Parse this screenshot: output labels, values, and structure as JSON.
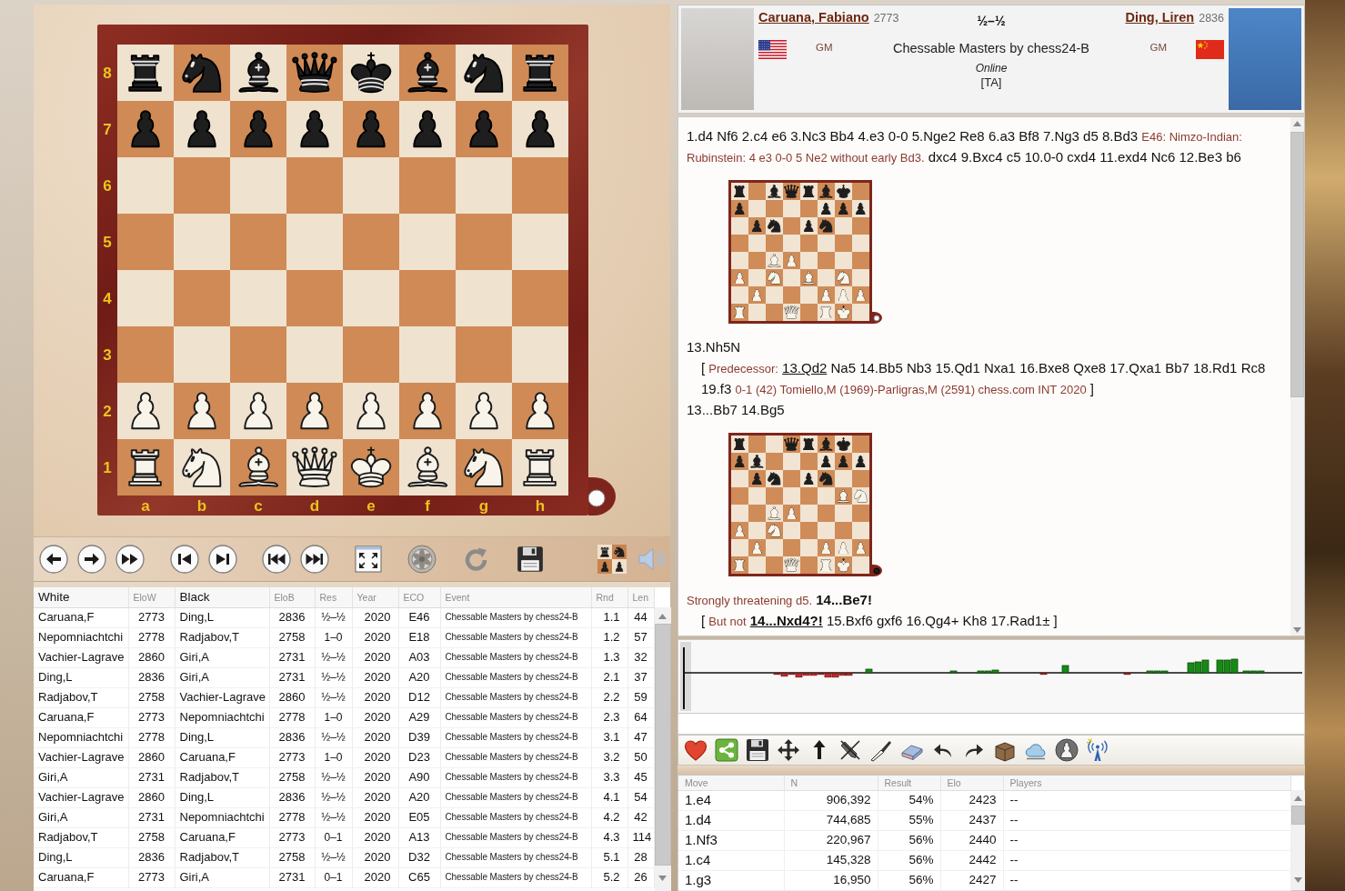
{
  "board": {
    "ranks": [
      {
        "label": "8",
        "squares": [
          {
            "kind": "rook",
            "color": "#1e1e1e"
          },
          {
            "kind": "knight",
            "color": "#1e1e1e"
          },
          {
            "kind": "bishop",
            "color": "#1e1e1e"
          },
          {
            "kind": "queen",
            "color": "#1e1e1e"
          },
          {
            "kind": "king",
            "color": "#1e1e1e"
          },
          {
            "kind": "bishop",
            "color": "#1e1e1e"
          },
          {
            "kind": "knight",
            "color": "#1e1e1e"
          },
          {
            "kind": "rook",
            "color": "#1e1e1e"
          }
        ]
      },
      {
        "label": "7",
        "squares": [
          {
            "kind": "pawn",
            "color": "#1e1e1e"
          },
          {
            "kind": "pawn",
            "color": "#1e1e1e"
          },
          {
            "kind": "pawn",
            "color": "#1e1e1e"
          },
          {
            "kind": "pawn",
            "color": "#1e1e1e"
          },
          {
            "kind": "pawn",
            "color": "#1e1e1e"
          },
          {
            "kind": "pawn",
            "color": "#1e1e1e"
          },
          {
            "kind": "pawn",
            "color": "#1e1e1e"
          },
          {
            "kind": "pawn",
            "color": "#1e1e1e"
          }
        ]
      },
      {
        "label": "6",
        "squares": [
          {
            "kind": "empty"
          },
          {
            "kind": "empty"
          },
          {
            "kind": "empty"
          },
          {
            "kind": "empty"
          },
          {
            "kind": "empty"
          },
          {
            "kind": "empty"
          },
          {
            "kind": "empty"
          },
          {
            "kind": "empty"
          }
        ]
      },
      {
        "label": "5",
        "squares": [
          {
            "kind": "empty"
          },
          {
            "kind": "empty"
          },
          {
            "kind": "empty"
          },
          {
            "kind": "empty"
          },
          {
            "kind": "empty"
          },
          {
            "kind": "empty"
          },
          {
            "kind": "empty"
          },
          {
            "kind": "empty"
          }
        ]
      },
      {
        "label": "4",
        "squares": [
          {
            "kind": "empty"
          },
          {
            "kind": "empty"
          },
          {
            "kind": "empty"
          },
          {
            "kind": "empty"
          },
          {
            "kind": "empty"
          },
          {
            "kind": "empty"
          },
          {
            "kind": "empty"
          },
          {
            "kind": "empty"
          }
        ]
      },
      {
        "label": "3",
        "squares": [
          {
            "kind": "empty"
          },
          {
            "kind": "empty"
          },
          {
            "kind": "empty"
          },
          {
            "kind": "empty"
          },
          {
            "kind": "empty"
          },
          {
            "kind": "empty"
          },
          {
            "kind": "empty"
          },
          {
            "kind": "empty"
          }
        ]
      },
      {
        "label": "2",
        "squares": [
          {
            "kind": "pawn",
            "color": "#f8f4ea"
          },
          {
            "kind": "pawn",
            "color": "#f8f4ea"
          },
          {
            "kind": "pawn",
            "color": "#f8f4ea"
          },
          {
            "kind": "pawn",
            "color": "#f8f4ea"
          },
          {
            "kind": "pawn",
            "color": "#f8f4ea"
          },
          {
            "kind": "pawn",
            "color": "#f8f4ea"
          },
          {
            "kind": "pawn",
            "color": "#f8f4ea"
          },
          {
            "kind": "pawn",
            "color": "#f8f4ea"
          }
        ]
      },
      {
        "label": "1",
        "squares": [
          {
            "kind": "rook",
            "color": "#f8f4ea"
          },
          {
            "kind": "knight",
            "color": "#f8f4ea"
          },
          {
            "kind": "bishop",
            "color": "#f8f4ea"
          },
          {
            "kind": "queen",
            "color": "#f8f4ea"
          },
          {
            "kind": "king",
            "color": "#f8f4ea"
          },
          {
            "kind": "bishop",
            "color": "#f8f4ea"
          },
          {
            "kind": "knight",
            "color": "#f8f4ea"
          },
          {
            "kind": "rook",
            "color": "#f8f4ea"
          }
        ]
      }
    ],
    "files": [
      "a",
      "b",
      "c",
      "d",
      "e",
      "f",
      "g",
      "h"
    ],
    "white_to_move": true
  },
  "game_list": {
    "columns": [
      {
        "label": "White",
        "emphasized": true
      },
      {
        "label": "EloW",
        "emphasized": false
      },
      {
        "label": "Black",
        "emphasized": true
      },
      {
        "label": "EloB",
        "emphasized": false
      },
      {
        "label": "Res",
        "emphasized": false
      },
      {
        "label": "Year",
        "emphasized": false
      },
      {
        "label": "ECO",
        "emphasized": false
      },
      {
        "label": "Event",
        "emphasized": false
      },
      {
        "label": "Rnd",
        "emphasized": false
      },
      {
        "label": "Len",
        "emphasized": false
      }
    ],
    "rows": [
      [
        "Caruana,F",
        "2773",
        "Ding,L",
        "2836",
        "½–½",
        "2020",
        "E46",
        "Chessable Masters by chess24-B",
        "1.1",
        "44"
      ],
      [
        "Nepomniachtchi",
        "2778",
        "Radjabov,T",
        "2758",
        "1–0",
        "2020",
        "E18",
        "Chessable Masters by chess24-B",
        "1.2",
        "57"
      ],
      [
        "Vachier-Lagrave",
        "2860",
        "Giri,A",
        "2731",
        "½–½",
        "2020",
        "A03",
        "Chessable Masters by chess24-B",
        "1.3",
        "32"
      ],
      [
        "Ding,L",
        "2836",
        "Giri,A",
        "2731",
        "½–½",
        "2020",
        "A20",
        "Chessable Masters by chess24-B",
        "2.1",
        "37"
      ],
      [
        "Radjabov,T",
        "2758",
        "Vachier-Lagrave",
        "2860",
        "½–½",
        "2020",
        "D12",
        "Chessable Masters by chess24-B",
        "2.2",
        "59"
      ],
      [
        "Caruana,F",
        "2773",
        "Nepomniachtchi",
        "2778",
        "1–0",
        "2020",
        "A29",
        "Chessable Masters by chess24-B",
        "2.3",
        "64"
      ],
      [
        "Nepomniachtchi",
        "2778",
        "Ding,L",
        "2836",
        "½–½",
        "2020",
        "D39",
        "Chessable Masters by chess24-B",
        "3.1",
        "47"
      ],
      [
        "Vachier-Lagrave",
        "2860",
        "Caruana,F",
        "2773",
        "1–0",
        "2020",
        "D23",
        "Chessable Masters by chess24-B",
        "3.2",
        "50"
      ],
      [
        "Giri,A",
        "2731",
        "Radjabov,T",
        "2758",
        "½–½",
        "2020",
        "A90",
        "Chessable Masters by chess24-B",
        "3.3",
        "45"
      ],
      [
        "Vachier-Lagrave",
        "2860",
        "Ding,L",
        "2836",
        "½–½",
        "2020",
        "A20",
        "Chessable Masters by chess24-B",
        "4.1",
        "54"
      ],
      [
        "Giri,A",
        "2731",
        "Nepomniachtchi",
        "2778",
        "½–½",
        "2020",
        "E05",
        "Chessable Masters by chess24-B",
        "4.2",
        "42"
      ],
      [
        "Radjabov,T",
        "2758",
        "Caruana,F",
        "2773",
        "0–1",
        "2020",
        "A13",
        "Chessable Masters by chess24-B",
        "4.3",
        "114"
      ],
      [
        "Ding,L",
        "2836",
        "Radjabov,T",
        "2758",
        "½–½",
        "2020",
        "D32",
        "Chessable Masters by chess24-B",
        "5.1",
        "28"
      ],
      [
        "Caruana,F",
        "2773",
        "Giri,A",
        "2731",
        "0–1",
        "2020",
        "C65",
        "Chessable Masters by chess24-B",
        "5.2",
        "26"
      ]
    ]
  },
  "game_header": {
    "players": [
      {
        "name": "Caruana, Fabiano",
        "elo": "2773",
        "title": "GM",
        "flag": {
          "kind": "us"
        }
      },
      {
        "name": "Ding, Liren",
        "elo": "2836",
        "title": "GM",
        "flag": {
          "kind": "cn"
        }
      }
    ],
    "result": "½–½",
    "event": "Chessable Masters by chess24-B",
    "site": "Online",
    "annotator": "[TA]"
  },
  "notation": [
    {
      "kind": "line",
      "segments": [
        {
          "kind": "move",
          "text": "1.d4 Nf6 2.c4 e6 3.Nc3 Bb4 4.e3 0-0 5.Nge2 Re8 6.a3 Bf8 7.Ng3 d5 8.Bd3"
        },
        {
          "kind": "comment",
          "text": "E46: Nimzo-Indian:"
        }
      ]
    },
    {
      "kind": "line",
      "segments": [
        {
          "kind": "comment",
          "text": "Rubinstein: 4 e3 0-0 5 Ne2 without early Bd3."
        },
        {
          "kind": "move",
          "text": "dxc4 9.Bxc4 c5 10.0-0 cxd4 11.exd4 Nc6 12.Be3 b6"
        }
      ]
    },
    {
      "kind": "diagram",
      "white_to_move": true,
      "ranks": [
        {
          "squares": [
            {
              "kind": "rook",
              "color": "#1e1e1e"
            },
            {
              "kind": "empty"
            },
            {
              "kind": "bishop",
              "color": "#1e1e1e"
            },
            {
              "kind": "queen",
              "color": "#1e1e1e"
            },
            {
              "kind": "rook",
              "color": "#1e1e1e"
            },
            {
              "kind": "bishop",
              "color": "#1e1e1e"
            },
            {
              "kind": "king",
              "color": "#1e1e1e"
            },
            {
              "kind": "empty"
            }
          ]
        },
        {
          "squares": [
            {
              "kind": "pawn",
              "color": "#1e1e1e"
            },
            {
              "kind": "empty"
            },
            {
              "kind": "empty"
            },
            {
              "kind": "empty"
            },
            {
              "kind": "empty"
            },
            {
              "kind": "pawn",
              "color": "#1e1e1e"
            },
            {
              "kind": "pawn",
              "color": "#1e1e1e"
            },
            {
              "kind": "pawn",
              "color": "#1e1e1e"
            }
          ]
        },
        {
          "squares": [
            {
              "kind": "empty"
            },
            {
              "kind": "pawn",
              "color": "#1e1e1e"
            },
            {
              "kind": "knight",
              "color": "#1e1e1e"
            },
            {
              "kind": "empty"
            },
            {
              "kind": "pawn",
              "color": "#1e1e1e"
            },
            {
              "kind": "knight",
              "color": "#1e1e1e"
            },
            {
              "kind": "empty"
            },
            {
              "kind": "empty"
            }
          ]
        },
        {
          "squares": [
            {
              "kind": "empty"
            },
            {
              "kind": "empty"
            },
            {
              "kind": "empty"
            },
            {
              "kind": "empty"
            },
            {
              "kind": "empty"
            },
            {
              "kind": "empty"
            },
            {
              "kind": "empty"
            },
            {
              "kind": "empty"
            }
          ]
        },
        {
          "squares": [
            {
              "kind": "empty"
            },
            {
              "kind": "empty"
            },
            {
              "kind": "bishop",
              "color": "#f8f4ea"
            },
            {
              "kind": "pawn",
              "color": "#f8f4ea"
            },
            {
              "kind": "empty"
            },
            {
              "kind": "empty"
            },
            {
              "kind": "empty"
            },
            {
              "kind": "empty"
            }
          ]
        },
        {
          "squares": [
            {
              "kind": "pawn",
              "color": "#f8f4ea"
            },
            {
              "kind": "empty"
            },
            {
              "kind": "knight",
              "color": "#f8f4ea"
            },
            {
              "kind": "empty"
            },
            {
              "kind": "bishop",
              "color": "#f8f4ea"
            },
            {
              "kind": "empty"
            },
            {
              "kind": "knight",
              "color": "#f8f4ea"
            },
            {
              "kind": "empty"
            }
          ]
        },
        {
          "squares": [
            {
              "kind": "empty"
            },
            {
              "kind": "pawn",
              "color": "#f8f4ea"
            },
            {
              "kind": "empty"
            },
            {
              "kind": "empty"
            },
            {
              "kind": "empty"
            },
            {
              "kind": "pawn",
              "color": "#f8f4ea"
            },
            {
              "kind": "pawn",
              "color": "#f8f4ea"
            },
            {
              "kind": "pawn",
              "color": "#f8f4ea"
            }
          ]
        },
        {
          "squares": [
            {
              "kind": "rook",
              "color": "#f8f4ea"
            },
            {
              "kind": "empty"
            },
            {
              "kind": "empty"
            },
            {
              "kind": "queen",
              "color": "#f8f4ea"
            },
            {
              "kind": "empty"
            },
            {
              "kind": "rook",
              "color": "#f8f4ea"
            },
            {
              "kind": "king",
              "color": "#f8f4ea"
            },
            {
              "kind": "empty"
            }
          ]
        }
      ]
    },
    {
      "kind": "line",
      "segments": [
        {
          "kind": "move",
          "text": "13.Nh5N"
        }
      ]
    },
    {
      "kind": "variation",
      "lines": [
        [
          {
            "kind": "bracket",
            "text": "["
          },
          {
            "kind": "comment",
            "text": "Predecessor:"
          },
          {
            "kind": "reference",
            "text": "13.Qd2"
          },
          {
            "kind": "move",
            "text": "Na5 14.Bb5 Nb3 15.Qd1 Nxa1 16.Bxe8 Qxe8 17.Qxa1 Bb7 18.Rd1 Rc8"
          }
        ],
        [
          {
            "kind": "move",
            "text": "19.f3"
          },
          {
            "kind": "comment",
            "text": "0-1 (42) Tomiello,M (1969)-Parligras,M (2591) chess.com INT 2020"
          },
          {
            "kind": "bracket",
            "text": "]"
          }
        ]
      ]
    },
    {
      "kind": "line",
      "segments": [
        {
          "kind": "move",
          "text": "13...Bb7 14.Bg5"
        }
      ]
    },
    {
      "kind": "diagram",
      "white_to_move": false,
      "ranks": [
        {
          "squares": [
            {
              "kind": "rook",
              "color": "#1e1e1e"
            },
            {
              "kind": "empty"
            },
            {
              "kind": "empty"
            },
            {
              "kind": "queen",
              "color": "#1e1e1e"
            },
            {
              "kind": "rook",
              "color": "#1e1e1e"
            },
            {
              "kind": "bishop",
              "color": "#1e1e1e"
            },
            {
              "kind": "king",
              "color": "#1e1e1e"
            },
            {
              "kind": "empty"
            }
          ]
        },
        {
          "squares": [
            {
              "kind": "pawn",
              "color": "#1e1e1e"
            },
            {
              "kind": "bishop",
              "color": "#1e1e1e"
            },
            {
              "kind": "empty"
            },
            {
              "kind": "empty"
            },
            {
              "kind": "empty"
            },
            {
              "kind": "pawn",
              "color": "#1e1e1e"
            },
            {
              "kind": "pawn",
              "color": "#1e1e1e"
            },
            {
              "kind": "pawn",
              "color": "#1e1e1e"
            }
          ]
        },
        {
          "squares": [
            {
              "kind": "empty"
            },
            {
              "kind": "pawn",
              "color": "#1e1e1e"
            },
            {
              "kind": "knight",
              "color": "#1e1e1e"
            },
            {
              "kind": "empty"
            },
            {
              "kind": "pawn",
              "color": "#1e1e1e"
            },
            {
              "kind": "knight",
              "color": "#1e1e1e"
            },
            {
              "kind": "empty"
            },
            {
              "kind": "empty"
            }
          ]
        },
        {
          "squares": [
            {
              "kind": "empty"
            },
            {
              "kind": "empty"
            },
            {
              "kind": "empty"
            },
            {
              "kind": "empty"
            },
            {
              "kind": "empty"
            },
            {
              "kind": "empty"
            },
            {
              "kind": "bishop",
              "color": "#f8f4ea"
            },
            {
              "kind": "knight",
              "color": "#f8f4ea"
            }
          ]
        },
        {
          "squares": [
            {
              "kind": "empty"
            },
            {
              "kind": "empty"
            },
            {
              "kind": "bishop",
              "color": "#f8f4ea"
            },
            {
              "kind": "pawn",
              "color": "#f8f4ea"
            },
            {
              "kind": "empty"
            },
            {
              "kind": "empty"
            },
            {
              "kind": "empty"
            },
            {
              "kind": "empty"
            }
          ]
        },
        {
          "squares": [
            {
              "kind": "pawn",
              "color": "#f8f4ea"
            },
            {
              "kind": "empty"
            },
            {
              "kind": "knight",
              "color": "#f8f4ea"
            },
            {
              "kind": "empty"
            },
            {
              "kind": "empty"
            },
            {
              "kind": "empty"
            },
            {
              "kind": "empty"
            },
            {
              "kind": "empty"
            }
          ]
        },
        {
          "squares": [
            {
              "kind": "empty"
            },
            {
              "kind": "pawn",
              "color": "#f8f4ea"
            },
            {
              "kind": "empty"
            },
            {
              "kind": "empty"
            },
            {
              "kind": "empty"
            },
            {
              "kind": "pawn",
              "color": "#f8f4ea"
            },
            {
              "kind": "pawn",
              "color": "#f8f4ea"
            },
            {
              "kind": "pawn",
              "color": "#f8f4ea"
            }
          ]
        },
        {
          "squares": [
            {
              "kind": "rook",
              "color": "#f8f4ea"
            },
            {
              "kind": "empty"
            },
            {
              "kind": "empty"
            },
            {
              "kind": "queen",
              "color": "#f8f4ea"
            },
            {
              "kind": "empty"
            },
            {
              "kind": "rook",
              "color": "#f8f4ea"
            },
            {
              "kind": "king",
              "color": "#f8f4ea"
            },
            {
              "kind": "empty"
            }
          ]
        }
      ]
    },
    {
      "kind": "line",
      "segments": [
        {
          "kind": "comment",
          "text": "Strongly threatening d5."
        },
        {
          "kind": "key_move",
          "text": "14...Be7!"
        }
      ]
    },
    {
      "kind": "variation",
      "lines": [
        [
          {
            "kind": "bracket",
            "text": "["
          },
          {
            "kind": "comment",
            "text": "But not"
          },
          {
            "kind": "key_reference",
            "text": "14...Nxd4?!"
          },
          {
            "kind": "move",
            "text": "15.Bxf6 gxf6 16.Qg4+ Kh8 17.Rad1±"
          },
          {
            "kind": "bracket",
            "text": "]"
          }
        ]
      ]
    }
  ],
  "opening_tree": {
    "columns": [
      "Move",
      "N",
      "Result",
      "Elo",
      "Players"
    ],
    "rows": [
      [
        "1.e4",
        "906,392",
        "54%",
        "2423",
        "--"
      ],
      [
        "1.d4",
        "744,685",
        "55%",
        "2437",
        "--"
      ],
      [
        "1.Nf3",
        "220,967",
        "56%",
        "2440",
        "--"
      ],
      [
        "1.c4",
        "145,328",
        "56%",
        "2442",
        "--"
      ],
      [
        "1.g3",
        "16,950",
        "56%",
        "2427",
        "--"
      ]
    ]
  }
}
